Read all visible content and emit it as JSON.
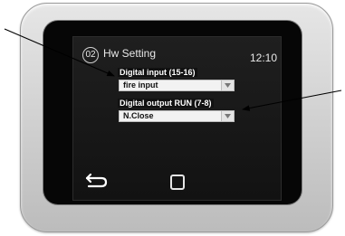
{
  "header": {
    "badge": "02",
    "title": "Hw Setting",
    "time": "12:10"
  },
  "fields": [
    {
      "label": "Digital input (15-16)",
      "value": "fire input"
    },
    {
      "label": "Digital output RUN (7-8)",
      "value": "N.Close"
    }
  ],
  "colors": {
    "screen_bg": "#161616",
    "text": "#e8e8e8",
    "select_bg": "#f2f2f2"
  },
  "icons": {
    "back": "back-arrow-icon",
    "home": "home-square-icon",
    "dropdown": "chevron-down-icon"
  }
}
